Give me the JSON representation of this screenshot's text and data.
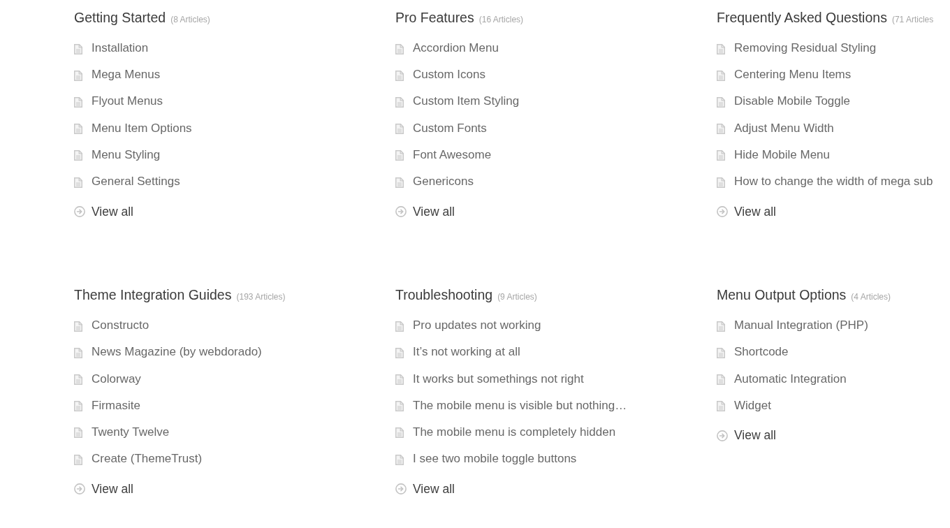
{
  "sections": [
    {
      "title": "Getting Started",
      "count": "(8 Articles)",
      "articles": [
        "Installation",
        "Mega Menus",
        "Flyout Menus",
        "Menu Item Options",
        "Menu Styling",
        "General Settings"
      ],
      "view_all": "View all"
    },
    {
      "title": "Pro Features",
      "count": "(16 Articles)",
      "articles": [
        "Accordion Menu",
        "Custom Icons",
        "Custom Item Styling",
        "Custom Fonts",
        "Font Awesome",
        "Genericons"
      ],
      "view_all": "View all"
    },
    {
      "title": "Frequently Asked Questions",
      "count": "(71 Articles",
      "articles": [
        "Removing Residual Styling",
        "Centering Menu Items",
        "Disable Mobile Toggle",
        "Adjust Menu Width",
        "Hide Mobile Menu",
        "How to change the width of mega sub"
      ],
      "view_all": "View all"
    },
    {
      "title": "Theme Integration Guides",
      "count": "(193 Articles)",
      "articles": [
        "Constructo",
        "News Magazine (by webdorado)",
        "Colorway",
        "Firmasite",
        "Twenty Twelve",
        "Create (ThemeTrust)"
      ],
      "view_all": "View all"
    },
    {
      "title": "Troubleshooting",
      "count": "(9 Articles)",
      "articles": [
        "Pro updates not working",
        "It’s not working at all",
        "It works but somethings not right",
        "The mobile menu is visible but nothing…",
        "The mobile menu is completely hidden",
        "I see two mobile toggle buttons"
      ],
      "view_all": "View all"
    },
    {
      "title": "Menu Output Options",
      "count": "(4 Articles)",
      "articles": [
        "Manual Integration (PHP)",
        "Shortcode",
        "Automatic Integration",
        "Widget"
      ],
      "view_all": "View all"
    }
  ]
}
